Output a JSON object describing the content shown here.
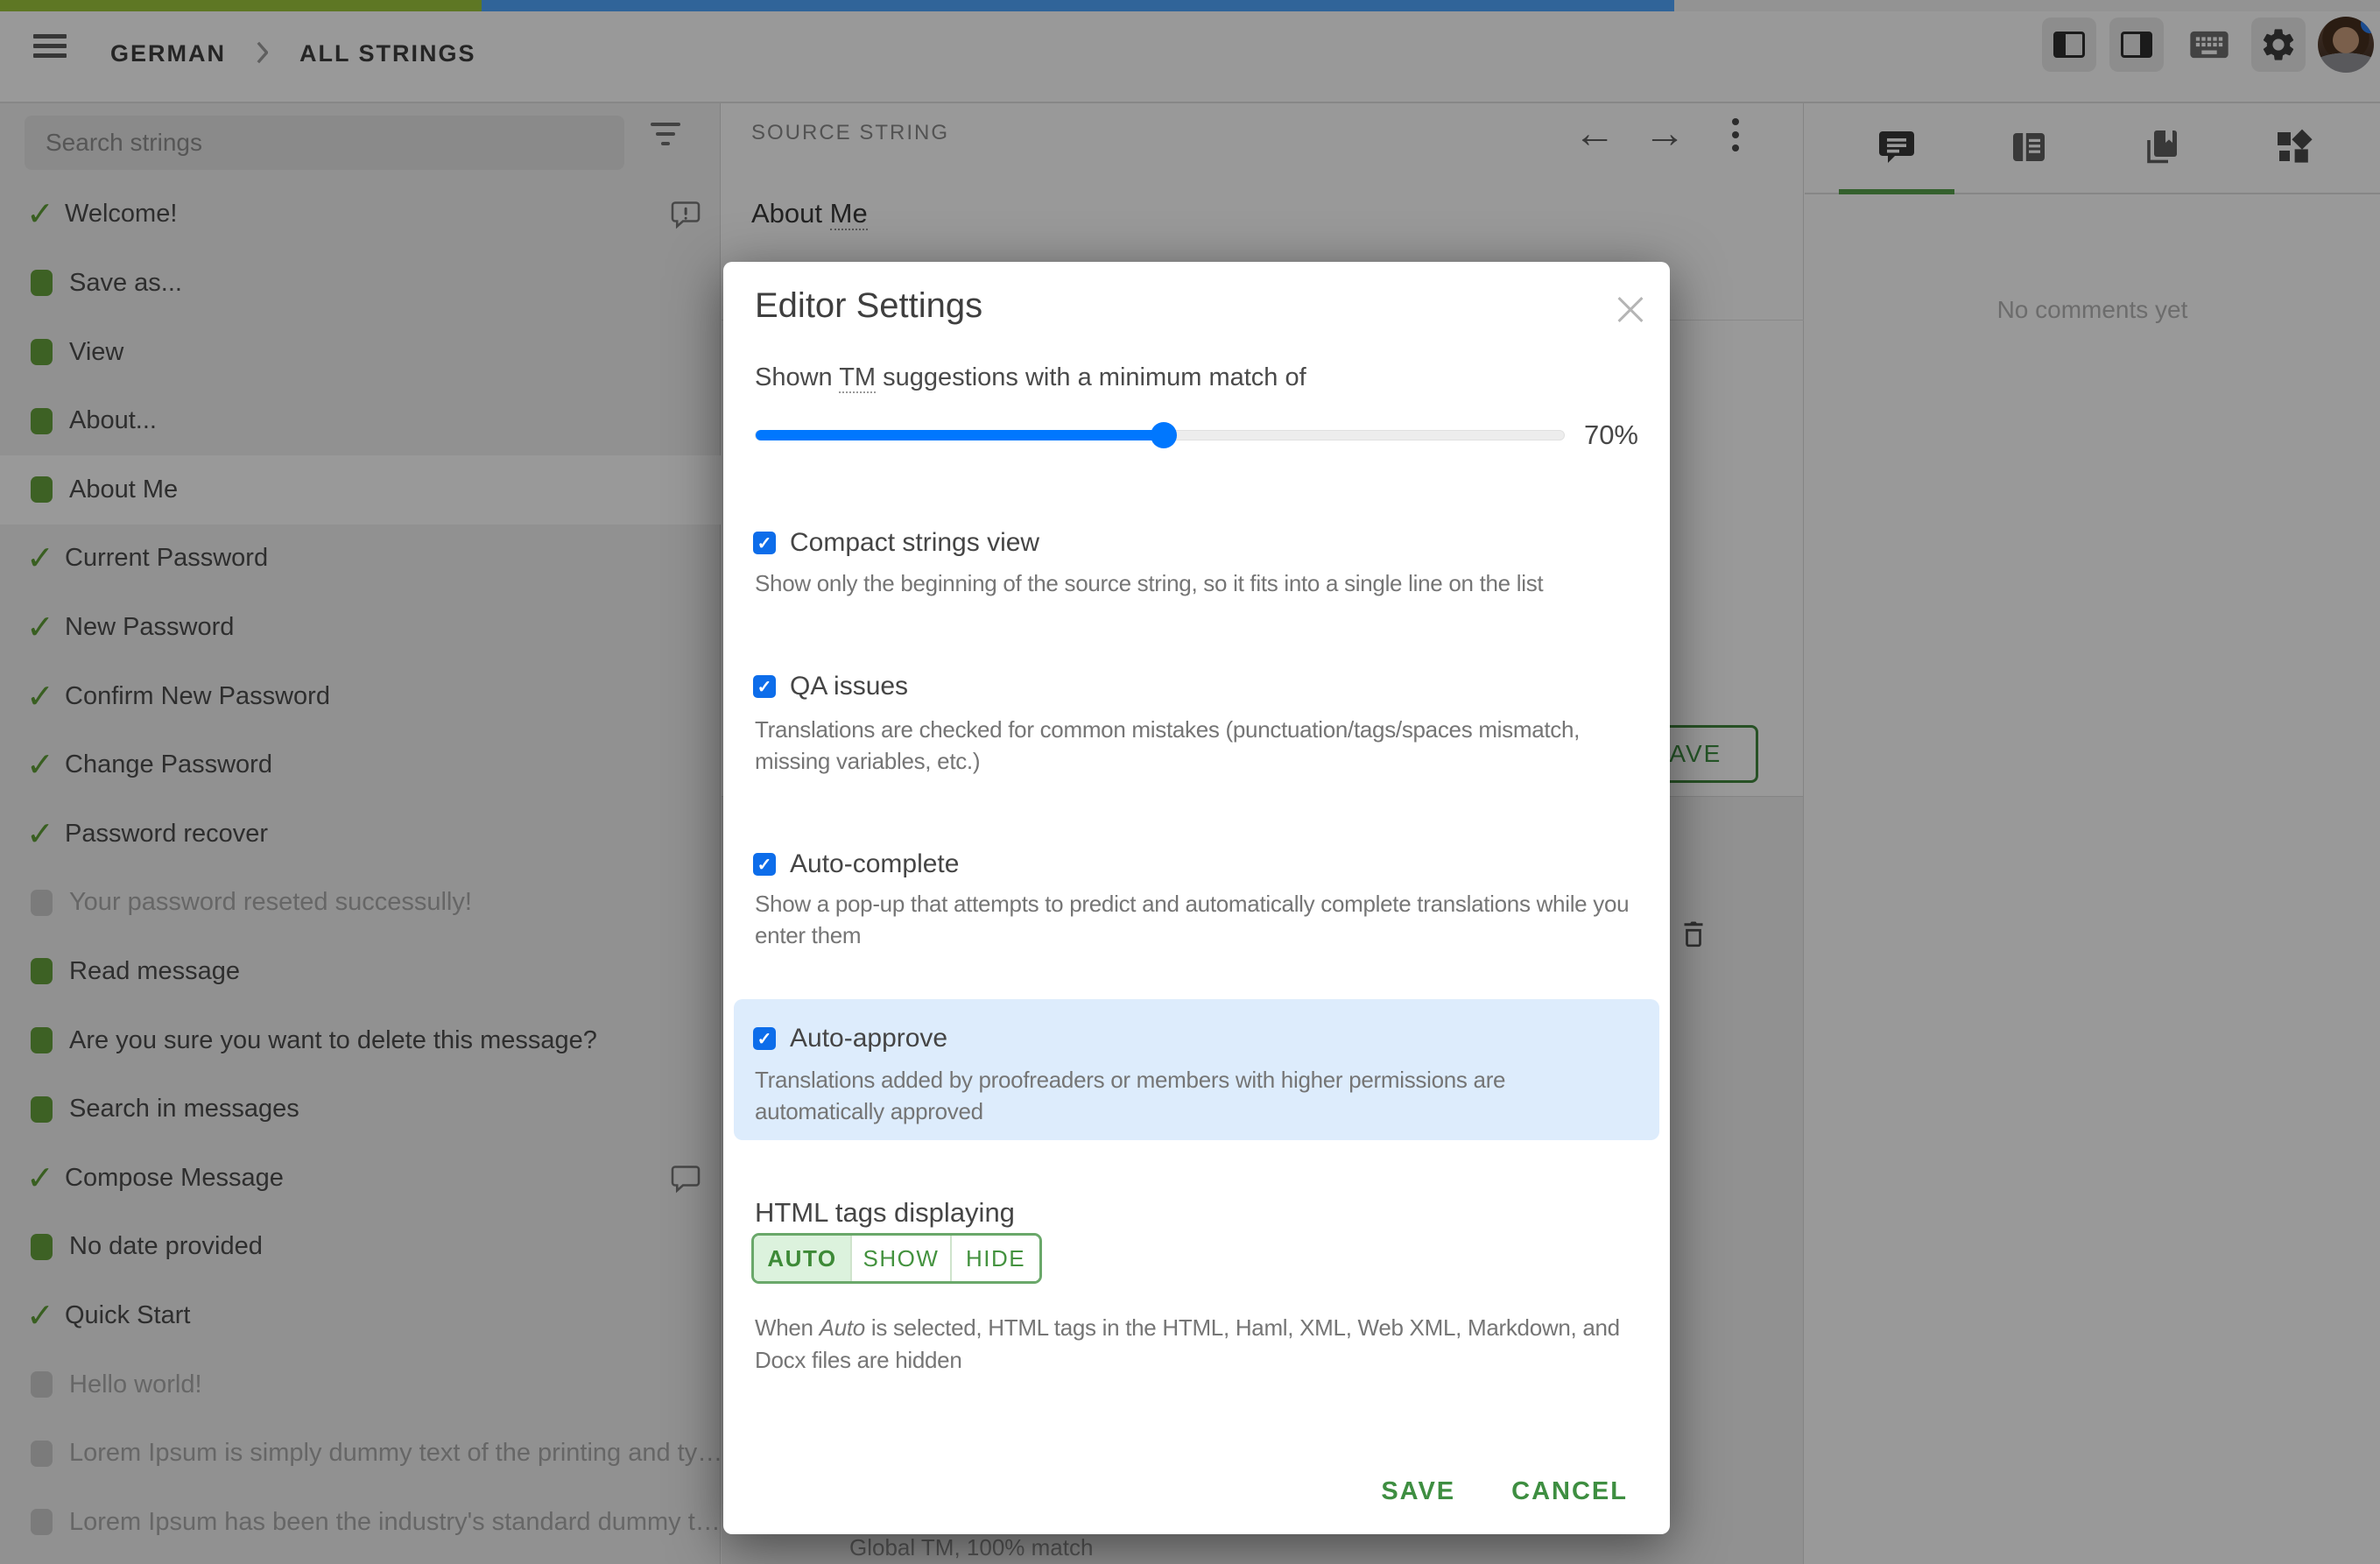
{
  "progress_bar": {
    "green_width": 550,
    "blue_width": 1362,
    "green": "#9dc63c",
    "blue": "#50a7ff",
    "rest": "#f5f5f5"
  },
  "header": {
    "breadcrumb": {
      "project": "GERMAN",
      "section": "ALL STRINGS"
    }
  },
  "sidebar": {
    "search_placeholder": "Search strings",
    "items": [
      {
        "label": "Welcome!",
        "status": "approved",
        "comment": "issue"
      },
      {
        "label": "Save as...",
        "status": "translated"
      },
      {
        "label": "View",
        "status": "translated"
      },
      {
        "label": "About...",
        "status": "translated"
      },
      {
        "label": "About Me",
        "status": "translated",
        "selected": true
      },
      {
        "label": "Current Password",
        "status": "approved"
      },
      {
        "label": "New Password",
        "status": "approved"
      },
      {
        "label": "Confirm New Password",
        "status": "approved"
      },
      {
        "label": "Change Password",
        "status": "approved"
      },
      {
        "label": "Password recover",
        "status": "approved"
      },
      {
        "label": "Your password reseted successully!",
        "status": "none"
      },
      {
        "label": "Read message",
        "status": "translated"
      },
      {
        "label": "Are you sure you want to delete this message?",
        "status": "translated"
      },
      {
        "label": "Search in messages",
        "status": "translated"
      },
      {
        "label": "Compose Message",
        "status": "approved",
        "comment": "plain"
      },
      {
        "label": "No date provided",
        "status": "translated"
      },
      {
        "label": "Quick Start",
        "status": "approved"
      },
      {
        "label": "Hello world!",
        "status": "none"
      },
      {
        "label": "Lorem Ipsum is simply dummy text of the printing and ty…",
        "status": "none"
      },
      {
        "label": "Lorem Ipsum has been the industry's standard dummy t…",
        "status": "none"
      }
    ]
  },
  "source_panel": {
    "label": "SOURCE STRING",
    "source_text": {
      "prefix": "About ",
      "term": "Me"
    },
    "save_label": "SAVE",
    "tm_suggestion": "Global TM, 100% match"
  },
  "right_panel": {
    "tabs": [
      "comments-tab",
      "context-tab",
      "translation-memory-tab",
      "machine-translation-tab"
    ],
    "empty_text": "No comments yet"
  },
  "modal": {
    "title": "Editor Settings",
    "tm_line": {
      "prefix": "Shown ",
      "term": "TM",
      "suffix": " suggestions with a minimum match of"
    },
    "slider": {
      "value_label": "70%",
      "fill_pct": 50.4
    },
    "options": [
      {
        "label": "Compact strings view",
        "checked": true,
        "desc": "Show only the beginning of the source string, so it fits into a single line on the list"
      },
      {
        "label": "QA issues",
        "checked": true,
        "desc": "Translations are checked for common mistakes (punctuation/tags/spaces mismatch,\nmissing variables, etc.)"
      },
      {
        "label": "Auto-complete",
        "checked": true,
        "desc": "Show a pop-up that attempts to predict and automatically complete translations while you\nenter them"
      },
      {
        "label": "Auto-approve",
        "checked": true,
        "highlight": true,
        "desc": "Translations added by proofreaders or members with higher permissions are\nautomatically approved"
      }
    ],
    "html_tags": {
      "label": "HTML tags displaying",
      "options": [
        "AUTO",
        "SHOW",
        "HIDE"
      ],
      "selected": "AUTO",
      "desc_prefix": "When ",
      "desc_italic": "Auto",
      "desc_suffix": " is selected, HTML tags in the HTML, Haml, XML, Web XML, Markdown, and\nDocx files are hidden"
    },
    "buttons": {
      "save": "SAVE",
      "cancel": "CANCEL"
    }
  },
  "colors": {
    "accent_green": "#3e8e41",
    "checkbox_blue": "#0d6dea",
    "slider_blue": "#0077fe",
    "highlight_blue": "#ddecfc"
  }
}
